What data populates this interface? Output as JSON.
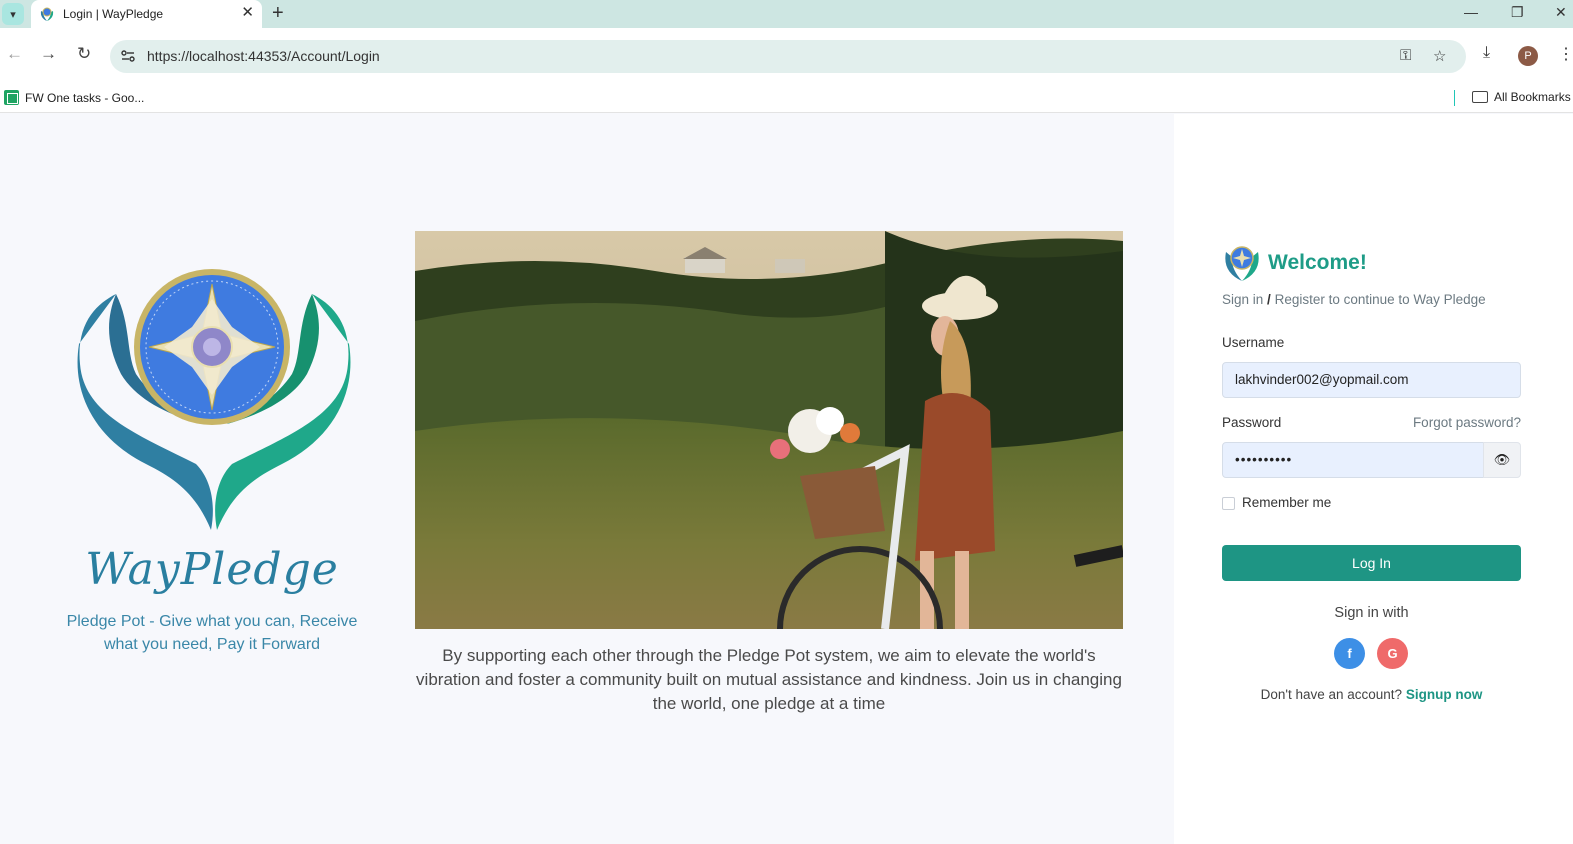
{
  "browser": {
    "tab_title": "Login | WayPledge",
    "tab_close": "✕",
    "new_tab": "+",
    "url": "https://localhost:44353/Account/Login",
    "bookmark_label": "FW One tasks - Goo...",
    "all_bookmarks": "All Bookmarks",
    "profile_initial": "P"
  },
  "left": {
    "brand_name": "WayPledge",
    "tagline": "Pledge Pot - Give what you can, Receive what you need, Pay it Forward"
  },
  "center": {
    "caption": "By supporting each other through the Pledge Pot system, we aim to elevate the world's vibration and foster a community built on mutual assistance and kindness. Join us in changing the world, one pledge at a time"
  },
  "login": {
    "welcome": "Welcome!",
    "sign_in": "Sign in",
    "slash": "/",
    "subtitle_rest": "Register to continue to Way Pledge",
    "username_label": "Username",
    "username_value": "lakhvinder002@yopmail.com",
    "password_label": "Password",
    "forgot": "Forgot password?",
    "password_value": "••••••••••",
    "remember": "Remember me",
    "login_button": "Log In",
    "sign_in_with": "Sign in with",
    "facebook": "f",
    "google": "G",
    "no_account": "Don't have an account?",
    "signup": "Signup now"
  },
  "colors": {
    "accent": "#1e9584",
    "facebook": "#3d8fe6",
    "google": "#ef6a6a"
  }
}
